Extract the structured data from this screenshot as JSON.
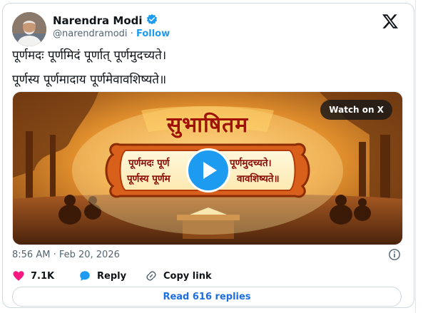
{
  "author": {
    "name": "Narendra Modi",
    "handle": "@narendramodi",
    "separator": "·",
    "follow_label": "Follow"
  },
  "tweet": {
    "line1": "पूर्णमदः पूर्णमिदं पूर्णात् पूर्णमुदच्यते।",
    "line2": "पूर्णस्य पूर्णमादाय पूर्णमेवावशिष्यते॥"
  },
  "media": {
    "watch_label": "Watch on X",
    "title": "सुभाषितम",
    "scroll_line1_left": "पूर्णमदः पूर्ण",
    "scroll_line1_right": "पूर्णमुदच्यते।",
    "scroll_line2_left": "पूर्णस्य पूर्णम",
    "scroll_line2_right": "वावशिष्यते॥"
  },
  "meta": {
    "timestamp": "8:56 AM · Feb 20, 2026"
  },
  "actions": {
    "likes": "7.1K",
    "reply_label": "Reply",
    "copy_label": "Copy link"
  },
  "replies_button": "Read 616 replies",
  "colors": {
    "accent": "#1d9bf0",
    "like": "#f91880",
    "secondary_text": "#536471"
  }
}
